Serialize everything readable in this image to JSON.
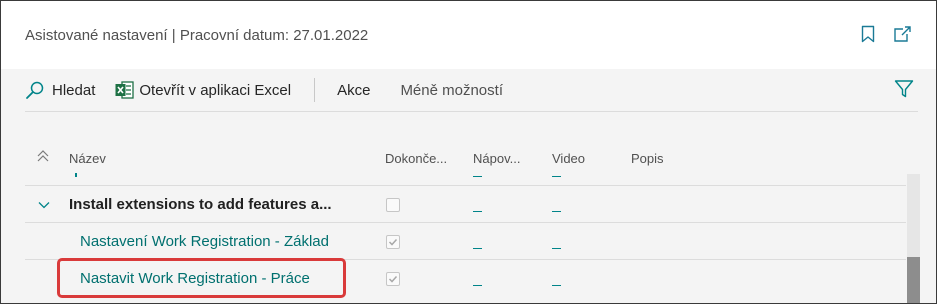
{
  "header": {
    "title": "Asistované nastavení | Pracovní datum: 27.01.2022",
    "bookmark_icon": "bookmark-icon",
    "popout_icon": "open-in-new-window-icon"
  },
  "toolbar": {
    "search_label": "Hledat",
    "excel_label": "Otevřít v aplikaci Excel",
    "actions_label": "Akce",
    "fewer_options_label": "Méně možností",
    "filter_icon": "filter-icon"
  },
  "columns": {
    "name": "Název",
    "completed": "Dokonče...",
    "help": "Nápov...",
    "video": "Video",
    "description": "Popis"
  },
  "rows": [
    {
      "name": "Install extensions to add features a...",
      "completed": false,
      "help": "_",
      "video": "_",
      "kind": "group"
    },
    {
      "name": "Nastavení Work Registration - Základ",
      "completed": true,
      "help": "_",
      "video": "_",
      "kind": "link"
    },
    {
      "name": "Nastavit Work Registration - Práce",
      "completed": true,
      "help": "_",
      "video": "_",
      "kind": "link"
    }
  ],
  "colors": {
    "accent": "#008489",
    "link": "#00706f",
    "highlight": "#d93a3a",
    "excel_green": "#1e7145"
  }
}
